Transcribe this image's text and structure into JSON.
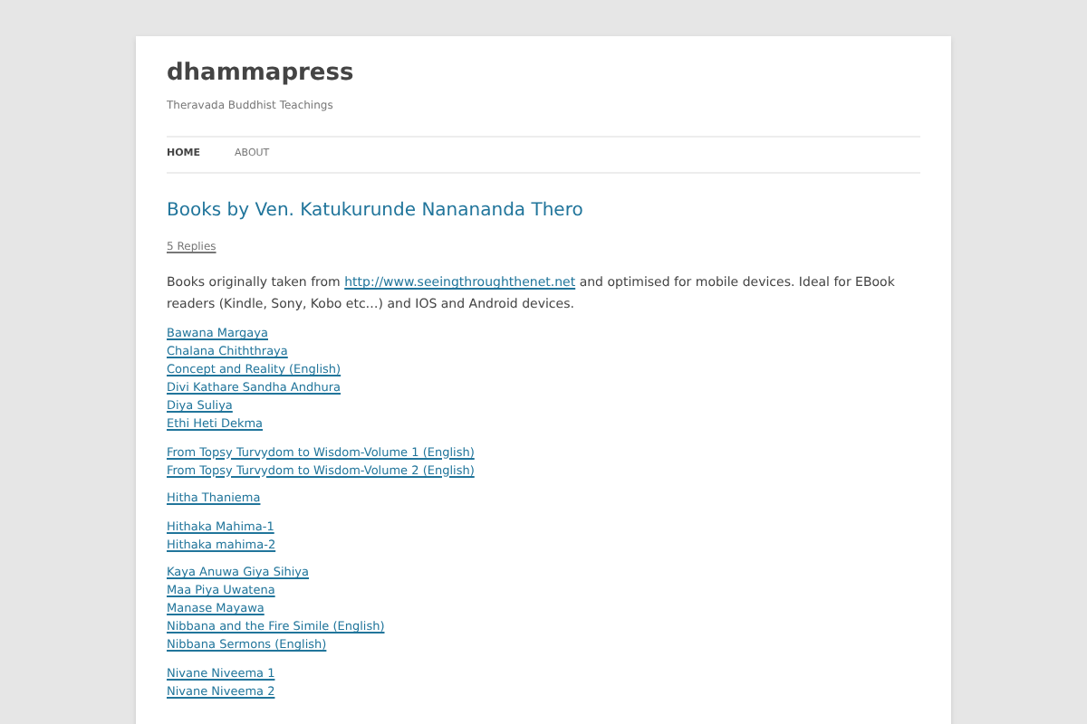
{
  "site": {
    "title": "dhammapress",
    "tagline": "Theravada Buddhist Teachings"
  },
  "nav": [
    {
      "label": "HOME",
      "selected": true
    },
    {
      "label": "ABOUT",
      "selected": false
    }
  ],
  "post": {
    "title": "Books by Ven. Katukurunde Nanananda Thero",
    "replies": "5 Replies",
    "intro": {
      "before": "Books originally taken from",
      "link": "http://www.seeingthroughthenet.net",
      "after": "and optimised for mobile devices. Ideal for EBook readers (Kindle, Sony, Kobo etc…) and IOS and Android devices."
    },
    "link_groups": [
      [
        "Bawana Margaya",
        "Chalana Chiththraya",
        "Concept and Reality (English)",
        "Divi Kathare Sandha Andhura",
        "Diya Suliya",
        "Ethi Heti Dekma"
      ],
      [
        "From Topsy Turvydom to Wisdom-Volume 1 (English)",
        "From Topsy Turvydom to Wisdom-Volume 2 (English)"
      ],
      [
        "Hitha Thaniema"
      ],
      [
        "Hithaka Mahima-1",
        "Hithaka mahima-2"
      ],
      [
        "Kaya Anuwa Giya Sihiya",
        "Maa Piya Uwatena",
        "Manase Mayawa",
        "Nibbana and the Fire Simile (English)",
        "Nibbana Sermons (English)"
      ],
      [
        "Nivane Niveema 1",
        "Nivane Niveema 2"
      ]
    ]
  }
}
